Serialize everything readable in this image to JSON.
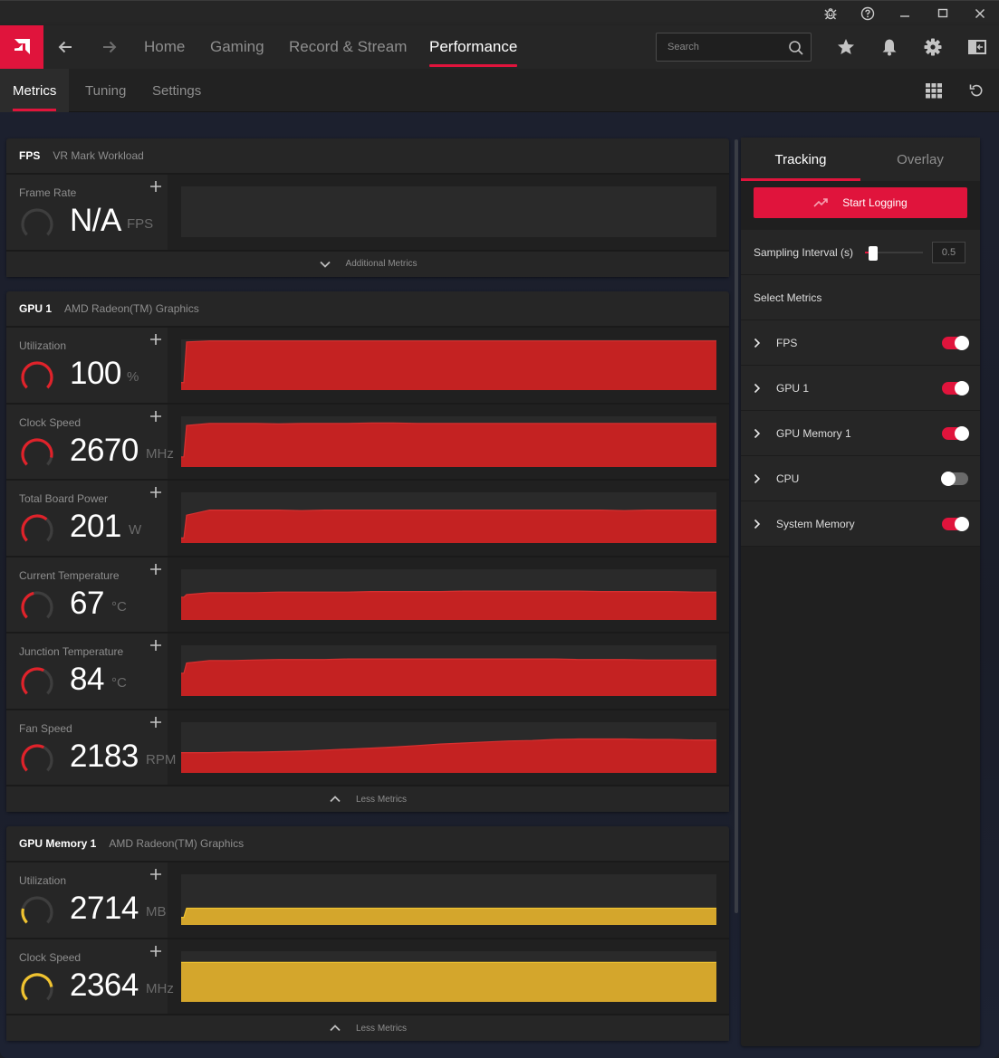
{
  "titlebar": {
    "icons": [
      "bug-report-icon",
      "help-icon",
      "minimize-icon",
      "maximize-icon",
      "close-icon"
    ]
  },
  "nav": {
    "logo": "amd-logo",
    "back": "back-arrow-icon",
    "forward": "forward-arrow-icon",
    "links": [
      {
        "label": "Home",
        "active": false
      },
      {
        "label": "Gaming",
        "active": false
      },
      {
        "label": "Record & Stream",
        "active": false
      },
      {
        "label": "Performance",
        "active": true
      }
    ],
    "search_placeholder": "Search",
    "right_icons": [
      "favorites-star-icon",
      "notifications-bell-icon",
      "settings-gear-icon",
      "sidebar-panel-icon"
    ]
  },
  "subnav": {
    "tabs": [
      {
        "label": "Metrics",
        "active": true
      },
      {
        "label": "Tuning",
        "active": false
      },
      {
        "label": "Settings",
        "active": false
      }
    ],
    "right_icons": [
      "grid-view-icon",
      "reset-icon"
    ]
  },
  "colors": {
    "accent": "#e0143c",
    "gpu_series": "#c42222",
    "memory_series": "#d4a62c",
    "gauge_track": "#3e3e3e"
  },
  "panels": [
    {
      "title": "FPS",
      "subtitle": "VR Mark Workload",
      "expander": {
        "label": "Additional Metrics",
        "direction": "down"
      },
      "metrics": [
        {
          "label": "Frame Rate",
          "value": "N/A",
          "unit": "FPS",
          "gauge_fraction": 0,
          "color": "#c42222",
          "series": []
        }
      ]
    },
    {
      "title": "GPU 1",
      "subtitle": "AMD Radeon(TM) Graphics",
      "expander": {
        "label": "Less Metrics",
        "direction": "up"
      },
      "metrics": [
        {
          "label": "Utilization",
          "value": "100",
          "unit": "%",
          "gauge_fraction": 1.0,
          "color": "#c42222",
          "series": [
            0.15,
            0.95,
            0.97,
            0.97,
            0.97,
            0.97,
            0.97,
            0.97,
            0.97,
            0.97,
            0.97,
            0.97,
            0.97,
            0.97,
            0.97,
            0.97,
            0.97,
            0.97,
            0.97,
            0.97,
            0.97,
            0.97,
            0.97,
            0.97,
            0.97
          ]
        },
        {
          "label": "Clock Speed",
          "value": "2670",
          "unit": "MHz",
          "gauge_fraction": 0.88,
          "color": "#c42222",
          "series": [
            0.2,
            0.82,
            0.86,
            0.86,
            0.86,
            0.85,
            0.86,
            0.86,
            0.86,
            0.87,
            0.87,
            0.86,
            0.86,
            0.86,
            0.86,
            0.86,
            0.86,
            0.86,
            0.86,
            0.86,
            0.86,
            0.86,
            0.86,
            0.86,
            0.86
          ]
        },
        {
          "label": "Total Board Power",
          "value": "201",
          "unit": "W",
          "gauge_fraction": 0.65,
          "color": "#c42222",
          "series": [
            0.1,
            0.55,
            0.65,
            0.65,
            0.65,
            0.65,
            0.64,
            0.65,
            0.65,
            0.65,
            0.65,
            0.65,
            0.65,
            0.65,
            0.65,
            0.65,
            0.65,
            0.65,
            0.65,
            0.65,
            0.64,
            0.65,
            0.65,
            0.65,
            0.65
          ]
        },
        {
          "label": "Current Temperature",
          "value": "67",
          "unit": "°C",
          "gauge_fraction": 0.45,
          "color": "#c42222",
          "series": [
            0.45,
            0.5,
            0.54,
            0.54,
            0.54,
            0.55,
            0.55,
            0.55,
            0.55,
            0.56,
            0.56,
            0.56,
            0.56,
            0.57,
            0.57,
            0.57,
            0.57,
            0.57,
            0.57,
            0.56,
            0.56,
            0.56,
            0.56,
            0.55,
            0.55
          ]
        },
        {
          "label": "Junction Temperature",
          "value": "84",
          "unit": "°C",
          "gauge_fraction": 0.6,
          "color": "#c42222",
          "series": [
            0.45,
            0.65,
            0.7,
            0.7,
            0.71,
            0.72,
            0.72,
            0.72,
            0.73,
            0.73,
            0.73,
            0.73,
            0.73,
            0.73,
            0.73,
            0.73,
            0.73,
            0.73,
            0.72,
            0.72,
            0.72,
            0.71,
            0.71,
            0.71,
            0.71
          ]
        },
        {
          "label": "Fan Speed",
          "value": "2183",
          "unit": "RPM",
          "gauge_fraction": 0.6,
          "color": "#c42222",
          "series": [
            0.4,
            0.4,
            0.4,
            0.41,
            0.41,
            0.42,
            0.43,
            0.45,
            0.47,
            0.49,
            0.51,
            0.54,
            0.57,
            0.59,
            0.61,
            0.63,
            0.64,
            0.66,
            0.67,
            0.67,
            0.67,
            0.66,
            0.66,
            0.65,
            0.65
          ]
        }
      ]
    },
    {
      "title": "GPU Memory 1",
      "subtitle": "AMD Radeon(TM) Graphics",
      "expander": {
        "label": "Less Metrics",
        "direction": "up"
      },
      "metrics": [
        {
          "label": "Utilization",
          "value": "2714",
          "unit": "MB",
          "gauge_fraction": 0.22,
          "color": "#d4a62c",
          "series": [
            0.15,
            0.33,
            0.33,
            0.33,
            0.33,
            0.33,
            0.33,
            0.33,
            0.33,
            0.33,
            0.33,
            0.33,
            0.33,
            0.33,
            0.33,
            0.33,
            0.33,
            0.33,
            0.33,
            0.33,
            0.33,
            0.33,
            0.33,
            0.33,
            0.33
          ]
        },
        {
          "label": "Clock Speed",
          "value": "2364",
          "unit": "MHz",
          "gauge_fraction": 0.8,
          "color": "#d4a62c",
          "series": [
            0.78,
            0.78,
            0.78,
            0.78,
            0.78,
            0.78,
            0.78,
            0.78,
            0.78,
            0.78,
            0.78,
            0.78,
            0.78,
            0.78,
            0.78,
            0.78,
            0.78,
            0.78,
            0.78,
            0.78,
            0.78,
            0.78,
            0.78,
            0.78,
            0.78
          ]
        }
      ]
    }
  ],
  "side": {
    "tabs": [
      {
        "label": "Tracking",
        "active": true
      },
      {
        "label": "Overlay",
        "active": false
      }
    ],
    "start_logging": "Start Logging",
    "sampling_label": "Sampling Interval (s)",
    "sampling_value": "0.5",
    "sampling_slider_fraction": 0.1,
    "select_metrics_label": "Select Metrics",
    "metric_toggles": [
      {
        "label": "FPS",
        "on": true
      },
      {
        "label": "GPU 1",
        "on": true
      },
      {
        "label": "GPU Memory 1",
        "on": true
      },
      {
        "label": "CPU",
        "on": false
      },
      {
        "label": "System Memory",
        "on": true
      }
    ]
  }
}
